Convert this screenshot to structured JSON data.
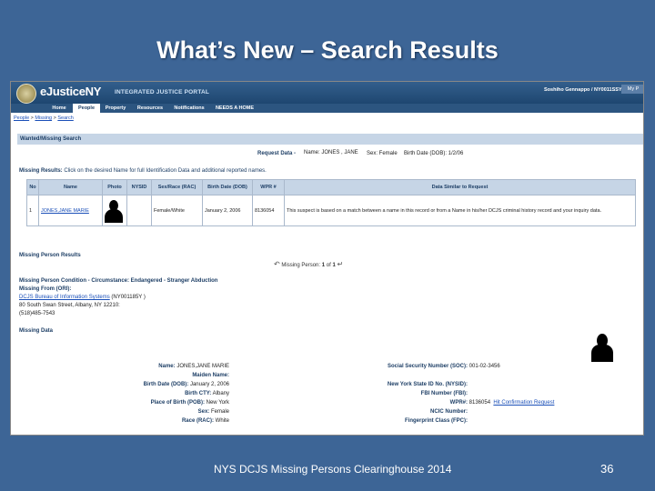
{
  "slide": {
    "title": "What’s New –  Search Results",
    "footer": "NYS DCJS Missing Persons Clearinghouse 2014",
    "page_number": "36"
  },
  "portal": {
    "brand": "eJusticeNY",
    "brand_sub": "INTEGRATED JUSTICE PORTAL",
    "user_info": "Soshiho Gennappo / NY0011SSY",
    "my_portal": "My P",
    "nav_tabs": [
      "Home",
      "People",
      "Property",
      "Resources",
      "Notifications",
      "NEEDS A HOME"
    ],
    "active_tab": "People"
  },
  "breadcrumb": {
    "items": [
      "People",
      "Missing",
      "Search"
    ],
    "separator": ">"
  },
  "search": {
    "section_title": "Wanted/Missing Search",
    "request_label": "Request Data -",
    "request_name": "Name: JONES , JANE",
    "request_sex": "Sex: Female",
    "request_dob": "Birth Date (DOB): 1/2/06",
    "results_label": "Missing Results:",
    "results_text": "Click on the desired Name for full Identification Data and additional reported names."
  },
  "results_table": {
    "headers": [
      "No",
      "Name",
      "Photo",
      "NYSID",
      "Sex/Race (RAC)",
      "Birth Date (DOB)",
      "WPR #",
      "Data Similar to Request"
    ],
    "rows": [
      {
        "no": "1",
        "name": "JONES,JANE MARIE",
        "nysid": "",
        "sex_race": "Female/White",
        "dob": "January 2, 2006",
        "wpr": "8136054",
        "similar": "This suspect is based on a match between a name in this record or from a Name in his/her DCJS criminal history record and your inquiry data."
      }
    ]
  },
  "missing_person": {
    "section_label": "Missing Person Results",
    "pager_label": "Missing Person:",
    "pager_current": "1",
    "pager_of": "of",
    "pager_total": "1",
    "condition": "Missing Person Condition - Circumstance: Endangered - Stranger Abduction",
    "missing_from_label": "Missing From (ORI):",
    "org_link": "DCJS   Bureau of Information Systems",
    "org_code": "(NY001185Y )",
    "address": "80 South Swan Street, Albany, NY 12210:",
    "phone": "(518)485-7543",
    "missing_data_label": "Missing Data"
  },
  "details_left": [
    {
      "label": "Name:",
      "value": "JONES,JANE MARIE"
    },
    {
      "label": "Maiden Name:",
      "value": ""
    },
    {
      "label": "Birth Date (DOB):",
      "value": "January 2, 2006"
    },
    {
      "label": "Birth CTY:",
      "value": "Albany"
    },
    {
      "label": "Place of Birth (POB):",
      "value": "New York"
    },
    {
      "label": "Sex:",
      "value": "Female"
    },
    {
      "label": "Race (RAC):",
      "value": "White"
    }
  ],
  "details_right": [
    {
      "label": "Social Security Number (SOC):",
      "value": "001-02-3456"
    },
    {
      "label": "New York State ID No. (NYSID):",
      "value": ""
    },
    {
      "label": "FBI Number (FBI):",
      "value": ""
    },
    {
      "label": "WPR#:",
      "value": "8136054",
      "link": "Hit Confirmation Request"
    },
    {
      "label": "NCIC Number:",
      "value": ""
    },
    {
      "label": "Fingerprint Class (FPC):",
      "value": ""
    }
  ]
}
